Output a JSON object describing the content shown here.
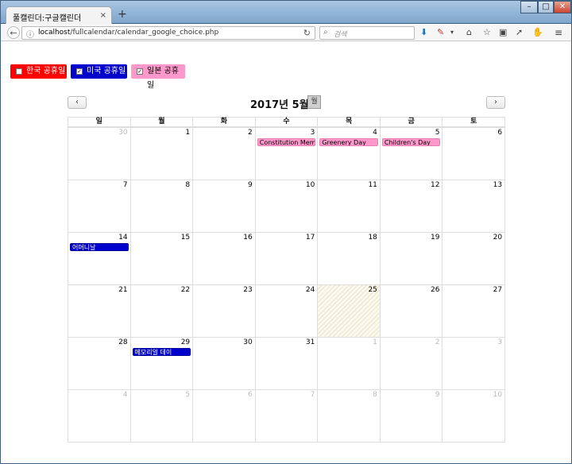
{
  "browser": {
    "tab_title": "풀캘린더:구글캘린더",
    "tab_close": "×",
    "new_tab": "+",
    "url_host": "localhost",
    "url_path": "/fullcalendar/calendar_google_choice.php",
    "search_placeholder": "검색"
  },
  "toggles": [
    {
      "label": "한국 공휴일",
      "checked": false,
      "color": "#ff0000"
    },
    {
      "label": "미국 공휴일",
      "checked": true,
      "color": "#0000cc"
    },
    {
      "label": "일본 공휴일",
      "checked": true,
      "color": "#ff99cc"
    }
  ],
  "calendar": {
    "title": "2017년 5월",
    "view_button": "월",
    "prev_label": "‹",
    "next_label": "›",
    "weekdays": [
      "일",
      "월",
      "화",
      "수",
      "목",
      "금",
      "토"
    ],
    "weeks": [
      [
        "30",
        "1",
        "2",
        "3",
        "4",
        "5",
        "6"
      ],
      [
        "7",
        "8",
        "9",
        "10",
        "11",
        "12",
        "13"
      ],
      [
        "14",
        "15",
        "16",
        "17",
        "18",
        "19",
        "20"
      ],
      [
        "21",
        "22",
        "23",
        "24",
        "25",
        "26",
        "27"
      ],
      [
        "28",
        "29",
        "30",
        "31",
        "1",
        "2",
        "3"
      ],
      [
        "4",
        "5",
        "6",
        "7",
        "8",
        "9",
        "10"
      ]
    ],
    "events": {
      "constitution": "Constitution Memorial",
      "greenery": "Greenery Day",
      "children": "Children's Day",
      "mothers": "어머니날",
      "memorial": "메모리얼 데이"
    }
  }
}
